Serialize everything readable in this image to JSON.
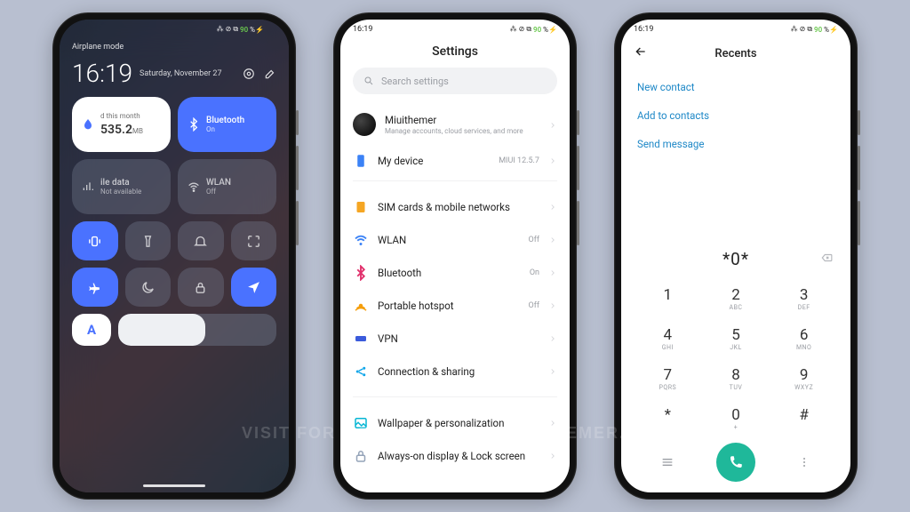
{
  "watermark": "VISIT FOR MORE THEMES - MIUITHEMER.COM",
  "status": {
    "time": "16:19",
    "icons": "⁂ ⊘ ⧉",
    "batt": "90",
    "tail": "%⚡"
  },
  "p1": {
    "head": "Airplane mode",
    "clock": "16:19",
    "date": "Saturday, November 27",
    "data": {
      "lab": "d this month",
      "val": "535.2",
      "unit": "MB"
    },
    "bt": {
      "title": "Bluetooth",
      "sub": "On"
    },
    "mobile": {
      "title": "ile data",
      "sub": "Not available"
    },
    "wlan": {
      "title": "WLAN",
      "sub": "Off"
    },
    "auto": "A"
  },
  "p2": {
    "title": "Settings",
    "search": "Search settings",
    "account": {
      "name": "Miuithemer",
      "sub": "Manage accounts, cloud services, and more"
    },
    "device": {
      "lab": "My device",
      "val": "MIUI 12.5.7"
    },
    "rows": [
      {
        "lab": "SIM cards & mobile networks",
        "ico": "sim",
        "c": "#f5a623"
      },
      {
        "lab": "WLAN",
        "val": "Off",
        "ico": "wifi",
        "c": "#3b82f6"
      },
      {
        "lab": "Bluetooth",
        "val": "On",
        "ico": "bt",
        "c": "#e1306c"
      },
      {
        "lab": "Portable hotspot",
        "val": "Off",
        "ico": "hotspot",
        "c": "#f59e0b"
      },
      {
        "lab": "VPN",
        "ico": "vpn",
        "c": "#3b5bdb"
      },
      {
        "lab": "Connection & sharing",
        "ico": "share",
        "c": "#0ea5e9"
      }
    ],
    "rows2": [
      {
        "lab": "Wallpaper & personalization",
        "ico": "wall",
        "c": "#06b6d4"
      },
      {
        "lab": "Always-on display & Lock screen",
        "ico": "lock",
        "c": "#94a3b8"
      }
    ]
  },
  "p3": {
    "title": "Recents",
    "actions": [
      "New contact",
      "Add to contacts",
      "Send message"
    ],
    "number": "*0*",
    "keys": [
      {
        "d": "1",
        "l": ""
      },
      {
        "d": "2",
        "l": "ABC"
      },
      {
        "d": "3",
        "l": "DEF"
      },
      {
        "d": "4",
        "l": "GHI"
      },
      {
        "d": "5",
        "l": "JKL"
      },
      {
        "d": "6",
        "l": "MNO"
      },
      {
        "d": "7",
        "l": "PQRS"
      },
      {
        "d": "8",
        "l": "TUV"
      },
      {
        "d": "9",
        "l": "WXYZ"
      },
      {
        "d": "*",
        "l": ""
      },
      {
        "d": "0",
        "l": "+"
      },
      {
        "d": "#",
        "l": ""
      }
    ]
  }
}
